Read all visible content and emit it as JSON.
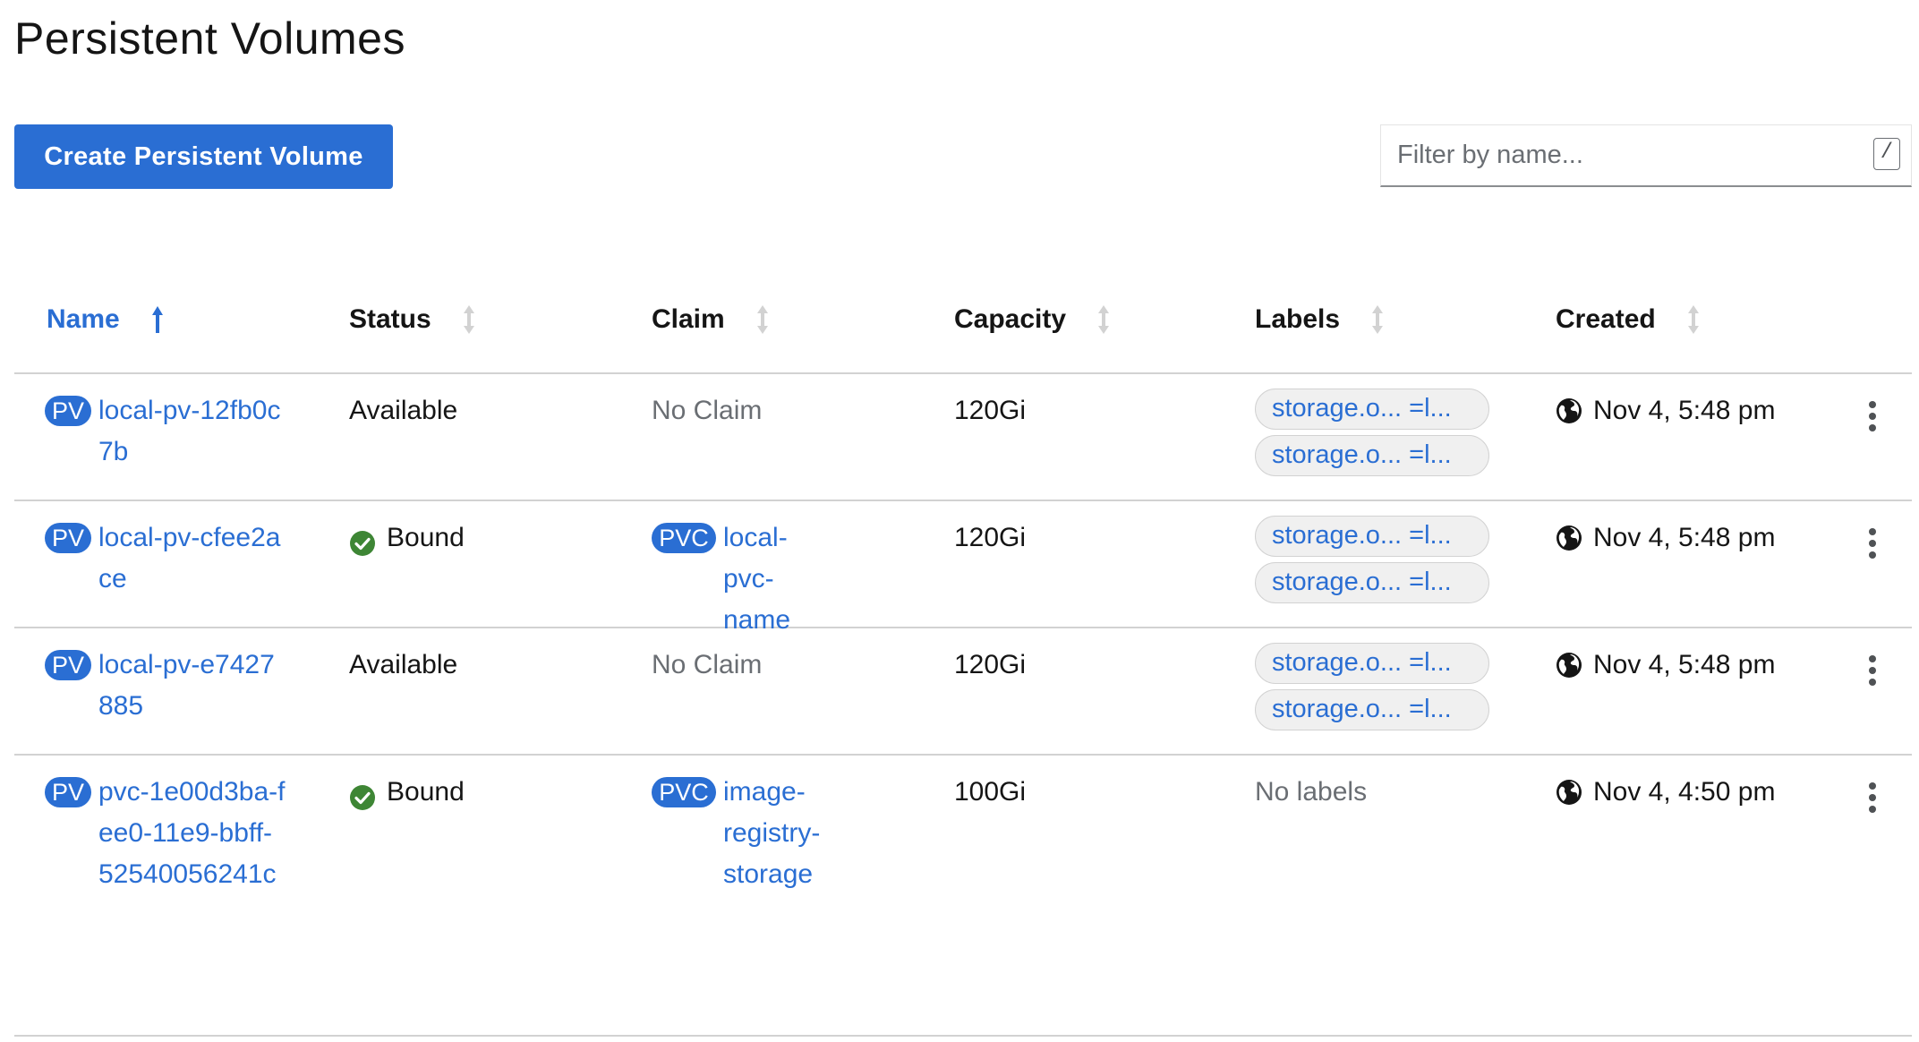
{
  "page": {
    "title": "Persistent Volumes",
    "create_button": "Create Persistent Volume",
    "filter_placeholder": "Filter by name...",
    "filter_shortcut": "/"
  },
  "table": {
    "columns": [
      {
        "label": "Name",
        "sorted": true
      },
      {
        "label": "Status",
        "sorted": false
      },
      {
        "label": "Claim",
        "sorted": false
      },
      {
        "label": "Capacity",
        "sorted": false
      },
      {
        "label": "Labels",
        "sorted": false
      },
      {
        "label": "Created",
        "sorted": false
      }
    ],
    "rows": [
      {
        "name_badge": "PV",
        "name": "local-pv-12fb0c7b",
        "status": "Available",
        "status_ok": false,
        "claim": "No Claim",
        "claim_badge": "",
        "capacity": "120Gi",
        "labels": [
          "storage.o... =l...",
          "storage.o... =l..."
        ],
        "created": "Nov 4, 5:48 pm"
      },
      {
        "name_badge": "PV",
        "name": "local-pv-cfee2ace",
        "status": "Bound",
        "status_ok": true,
        "claim": "local-pvc-name",
        "claim_badge": "PVC",
        "capacity": "120Gi",
        "labels": [
          "storage.o... =l...",
          "storage.o... =l..."
        ],
        "created": "Nov 4, 5:48 pm"
      },
      {
        "name_badge": "PV",
        "name": "local-pv-e7427885",
        "status": "Available",
        "status_ok": false,
        "claim": "No Claim",
        "claim_badge": "",
        "capacity": "120Gi",
        "labels": [
          "storage.o... =l...",
          "storage.o... =l..."
        ],
        "created": "Nov 4, 5:48 pm"
      },
      {
        "name_badge": "PV",
        "name": "pvc-1e00d3ba-fee0-11e9-bbff-52540056241c",
        "status": "Bound",
        "status_ok": true,
        "claim": "image-registry-storage",
        "claim_badge": "PVC",
        "capacity": "100Gi",
        "labels": [],
        "no_labels": "No labels",
        "created": "Nov 4, 4:50 pm"
      }
    ]
  },
  "colors": {
    "accent": "#2a6ed3",
    "success": "#3e8635",
    "muted": "#6a6e73",
    "border": "#d2d2d2"
  },
  "icons": {
    "sort_active": "arrow-up-icon",
    "sort_inactive": "sort-icon",
    "status_ok": "check-circle-icon",
    "created": "globe-icon",
    "row_menu": "kebab-icon"
  }
}
